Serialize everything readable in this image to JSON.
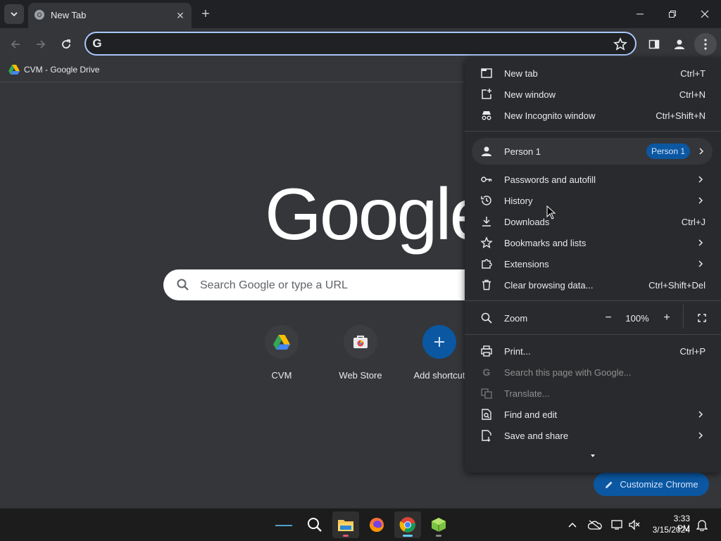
{
  "window": {
    "tab_title": "New Tab",
    "new_tab_glyph": "+",
    "close_glyph": "✕"
  },
  "toolbar": {
    "omnibox_icon": "G",
    "omnibox_value": ""
  },
  "bookmarks": [
    {
      "label": "CVM - Google Drive",
      "icon": "google-drive-icon"
    }
  ],
  "ntp": {
    "logo": "Google",
    "search_placeholder": "Search Google or type a URL",
    "shortcuts": [
      {
        "label": "CVM",
        "icon": "google-drive-icon"
      },
      {
        "label": "Web Store",
        "icon": "web-store-icon"
      },
      {
        "label": "Add shortcut",
        "icon": "plus-icon"
      }
    ],
    "customize_label": "Customize Chrome"
  },
  "menu": {
    "group1": [
      {
        "label": "New tab",
        "shortcut": "Ctrl+T",
        "icon": "new-tab-icon"
      },
      {
        "label": "New window",
        "shortcut": "Ctrl+N",
        "icon": "new-window-icon"
      },
      {
        "label": "New Incognito window",
        "shortcut": "Ctrl+Shift+N",
        "icon": "incognito-icon"
      }
    ],
    "person": {
      "label": "Person 1",
      "badge": "Person 1",
      "icon": "person-icon"
    },
    "group2": [
      {
        "label": "Passwords and autofill",
        "shortcut": "",
        "icon": "key-icon",
        "submenu": true
      },
      {
        "label": "History",
        "shortcut": "",
        "icon": "history-icon",
        "submenu": true
      },
      {
        "label": "Downloads",
        "shortcut": "Ctrl+J",
        "icon": "download-icon",
        "submenu": false
      },
      {
        "label": "Bookmarks and lists",
        "shortcut": "",
        "icon": "star-icon",
        "submenu": true
      },
      {
        "label": "Extensions",
        "shortcut": "",
        "icon": "extension-icon",
        "submenu": true
      },
      {
        "label": "Clear browsing data...",
        "shortcut": "Ctrl+Shift+Del",
        "icon": "trash-icon",
        "submenu": false
      }
    ],
    "zoom": {
      "label": "Zoom",
      "value": "100%",
      "minus": "−",
      "plus": "+"
    },
    "group3": [
      {
        "label": "Print...",
        "shortcut": "Ctrl+P",
        "icon": "print-icon",
        "submenu": false,
        "disabled": false
      },
      {
        "label": "Search this page with Google...",
        "shortcut": "",
        "icon": "google-g-icon",
        "submenu": false,
        "disabled": true
      },
      {
        "label": "Translate...",
        "shortcut": "",
        "icon": "translate-icon",
        "submenu": false,
        "disabled": true
      },
      {
        "label": "Find and edit",
        "shortcut": "",
        "icon": "find-icon",
        "submenu": true,
        "disabled": false
      },
      {
        "label": "Save and share",
        "shortcut": "",
        "icon": "save-share-icon",
        "submenu": true,
        "disabled": false
      }
    ]
  },
  "taskbar": {
    "time": "3:33 PM",
    "date": "3/15/2024"
  },
  "colors": {
    "accent": "#a8c7fa",
    "badge": "#0b57a1",
    "menu_bg": "#292a2d",
    "page_bg": "#35363a"
  }
}
